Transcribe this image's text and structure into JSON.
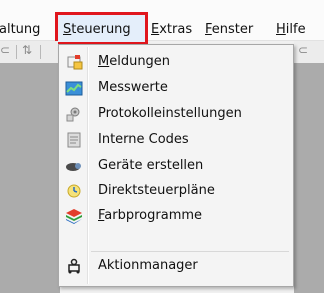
{
  "menubar": {
    "items": [
      {
        "pre": "",
        "u": "",
        "post": "altung"
      },
      {
        "pre": "",
        "u": "S",
        "post": "teuerung"
      },
      {
        "pre": "",
        "u": "E",
        "post": "xtras"
      },
      {
        "pre": "",
        "u": "F",
        "post": "enster"
      },
      {
        "pre": "",
        "u": "H",
        "post": "ilfe"
      }
    ]
  },
  "menu": {
    "items": [
      {
        "pre": "",
        "u": "M",
        "post": "eldungen",
        "icon": "messages-icon"
      },
      {
        "pre": "Messwerte",
        "u": "",
        "post": "",
        "icon": "chart-icon"
      },
      {
        "pre": "Protokolleinstellungen",
        "u": "",
        "post": "",
        "icon": "protocol-settings-icon"
      },
      {
        "pre": "Interne Codes",
        "u": "",
        "post": "",
        "icon": "internal-codes-icon"
      },
      {
        "pre": "Geräte erstellen",
        "u": "",
        "post": "",
        "icon": "create-devices-icon"
      },
      {
        "pre": "Direktsteuerpläne",
        "u": "",
        "post": "",
        "icon": "direct-control-plans-icon"
      },
      {
        "pre": "",
        "u": "F",
        "post": "arbprogramme",
        "icon": "color-programs-icon"
      },
      {
        "pre": "Aktionmanager",
        "u": "",
        "post": "",
        "icon": "action-manager-icon"
      }
    ]
  },
  "colors": {
    "highlight_border": "#e0161d",
    "highlight_fill": "#e4eefa",
    "workarea": "#ababab"
  }
}
